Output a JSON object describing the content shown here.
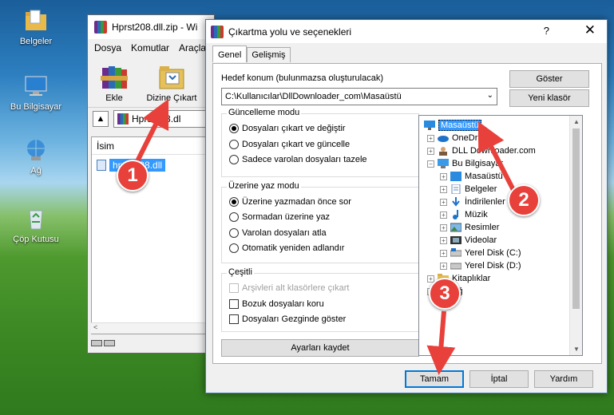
{
  "desktop": {
    "icons": [
      {
        "label": "Belgeler",
        "icon": "folder-documents-icon"
      },
      {
        "label": "Bu Bilgisayar",
        "icon": "computer-icon"
      },
      {
        "label": "Ağ",
        "icon": "network-icon"
      },
      {
        "label": "Çöp Kutusu",
        "icon": "recycle-bin-icon"
      }
    ]
  },
  "rar_window": {
    "title": "Hprst208.dll.zip - Wi",
    "menu": [
      "Dosya",
      "Komutlar",
      "Araçla"
    ],
    "toolbar": {
      "add_label": "Ekle",
      "extract_label": "Dizine Çıkart"
    },
    "path": "Hprst208.dl",
    "list_header": "İsim",
    "file_name": "hprst208.dll",
    "hscroll_left": "<"
  },
  "dialog": {
    "title": "Çıkartma yolu ve seçenekleri",
    "help": "?",
    "close": "✕",
    "tabs": [
      "Genel",
      "Gelişmiş"
    ],
    "target_label": "Hedef konum (bulunmazsa oluşturulacak)",
    "target_path": "C:\\Kullanıcılar\\DllDownloader_com\\Masaüstü",
    "show_button": "Göster",
    "new_folder_button": "Yeni klasör",
    "update_group": {
      "title": "Güncelleme modu",
      "options": [
        "Dosyaları çıkart ve değiştir",
        "Dosyaları çıkart ve güncelle",
        "Sadece varolan dosyaları tazele"
      ],
      "selected": 0
    },
    "overwrite_group": {
      "title": "Üzerine yaz modu",
      "options": [
        "Üzerine yazmadan önce sor",
        "Sormadan üzerine yaz",
        "Varolan dosyaları atla",
        "Otomatik yeniden adlandır"
      ],
      "selected": 0
    },
    "misc_group": {
      "title": "Çeşitli",
      "options": [
        "Arşivleri alt klasörlere çıkart",
        "Bozuk dosyaları koru",
        "Dosyaları Gezginde göster"
      ]
    },
    "save_settings_button": "Ayarları kaydet",
    "tree": [
      {
        "label": "Masaüstü",
        "icon": "desktop-icon",
        "selected": true
      },
      {
        "label": "OneDrive",
        "icon": "cloud-icon"
      },
      {
        "label": "DLL Downloader.com",
        "icon": "user-icon"
      },
      {
        "label": "Bu Bilgisayar",
        "icon": "computer-icon"
      },
      {
        "label": "Masaüstü",
        "icon": "desktop-icon"
      },
      {
        "label": "Belgeler",
        "icon": "documents-icon"
      },
      {
        "label": "İndirilenler",
        "icon": "download-icon"
      },
      {
        "label": "Müzik",
        "icon": "music-icon"
      },
      {
        "label": "Resimler",
        "icon": "pictures-icon"
      },
      {
        "label": "Videolar",
        "icon": "videos-icon"
      },
      {
        "label": "Yerel Disk (C:)",
        "icon": "drive-icon"
      },
      {
        "label": "Yerel Disk (D:)",
        "icon": "drive-icon"
      },
      {
        "label": "Kitaplıklar",
        "icon": "folder-icon"
      },
      {
        "label": "Ağ",
        "icon": "network-icon"
      }
    ],
    "ok_button": "Tamam",
    "cancel_button": "İptal",
    "help_button": "Yardım"
  },
  "annotations": [
    "1",
    "2",
    "3"
  ],
  "colors": {
    "accent": "#0078d7",
    "annotation": "#e8403a",
    "selection": "#3399ff"
  }
}
